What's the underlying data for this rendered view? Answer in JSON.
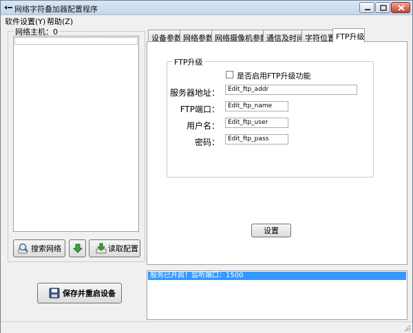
{
  "window": {
    "title": "网络字符叠加器配置程序"
  },
  "menu": {
    "software_settings": "软件设置(Y)",
    "help": "帮助(Z)"
  },
  "host_group": {
    "title": "网络主机：0"
  },
  "buttons": {
    "search": "搜索网络",
    "read_config": "读取配置",
    "save_restart": "保存并重启设备",
    "set": "设置"
  },
  "tabs": [
    {
      "label": "设备参数"
    },
    {
      "label": "网络参数"
    },
    {
      "label": "网络摄像机参数"
    },
    {
      "label": "通信及时间"
    },
    {
      "label": "字符位置"
    },
    {
      "label": "FTP升级"
    }
  ],
  "ftp": {
    "group_title": "FTP升级",
    "enable_label": "是否启用FTP升级功能",
    "enabled": false,
    "server_label": "服务器地址：",
    "server_value": "Edit_ftp_addr",
    "port_label": "FTP端口：",
    "port_value": "Edit_ftp_name",
    "user_label": "用户名：",
    "user_value": "Edit_ftp_user",
    "pass_label": "密码：",
    "pass_value": "Edit_ftp_pass"
  },
  "log": {
    "message": "服务已开启！监听端口：1500"
  },
  "colors": {
    "selection": "#3399ff",
    "title_gradient_top": "#dbe7f5",
    "close_button": "#c7402c"
  },
  "icons": {
    "app": "app-icon",
    "search": "magnifier-icon",
    "down": "green-arrow-down-icon",
    "read": "download-tray-icon",
    "save": "floppy-disk-icon"
  }
}
